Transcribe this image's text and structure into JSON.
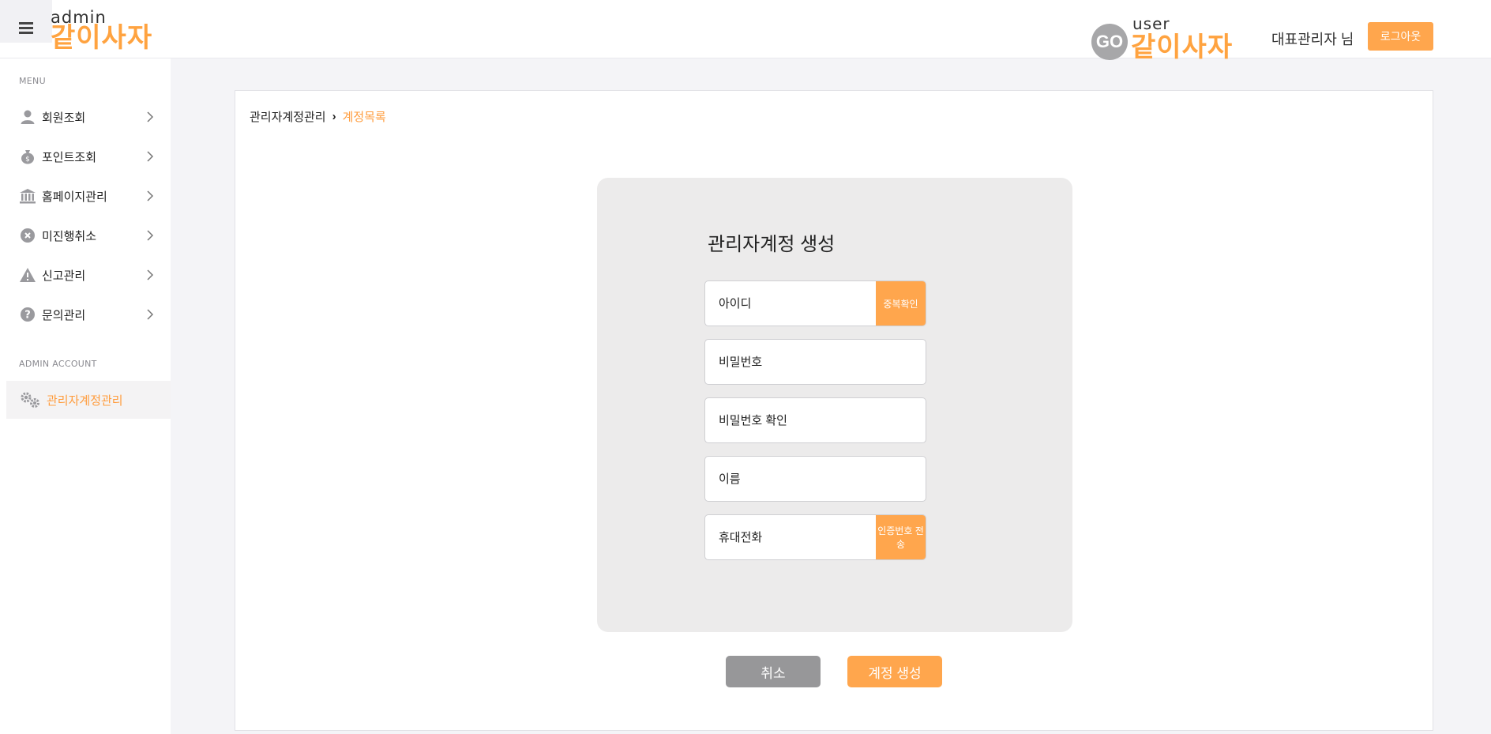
{
  "header": {
    "admin_logo_small": "admin",
    "admin_logo_big": "같이사자",
    "user_logo_go": "GO",
    "user_logo_small": "user",
    "user_logo_big": "같이사자",
    "admin_name": "대표관리자 님",
    "logout_label": "로그아웃"
  },
  "sidebar": {
    "menu_title": "MENU",
    "items": [
      {
        "label": "회원조회",
        "icon": "user-icon"
      },
      {
        "label": "포인트조회",
        "icon": "money-bag-icon"
      },
      {
        "label": "홈페이지관리",
        "icon": "bank-icon"
      },
      {
        "label": "미진행취소",
        "icon": "x-circle-icon"
      },
      {
        "label": "신고관리",
        "icon": "warning-icon"
      },
      {
        "label": "문의관리",
        "icon": "question-circle-icon"
      }
    ],
    "admin_title": "ADMIN ACCOUNT",
    "admin_item": {
      "label": "관리자계정관리",
      "icon": "gears-icon"
    }
  },
  "breadcrumb": {
    "parent": "관리자계정관리",
    "current": "계정목록"
  },
  "form": {
    "title": "관리자계정 생성",
    "id_placeholder": "아이디",
    "dup_check_label": "중복확인",
    "password_placeholder": "비밀번호",
    "password_confirm_placeholder": "비밀번호 확인",
    "name_placeholder": "이름",
    "phone_placeholder": "휴대전화",
    "send_code_label": "인증번호 전송"
  },
  "actions": {
    "cancel_label": "취소",
    "create_label": "계정 생성"
  },
  "colors": {
    "accent": "#ffa64d",
    "gray_button": "#979799"
  }
}
